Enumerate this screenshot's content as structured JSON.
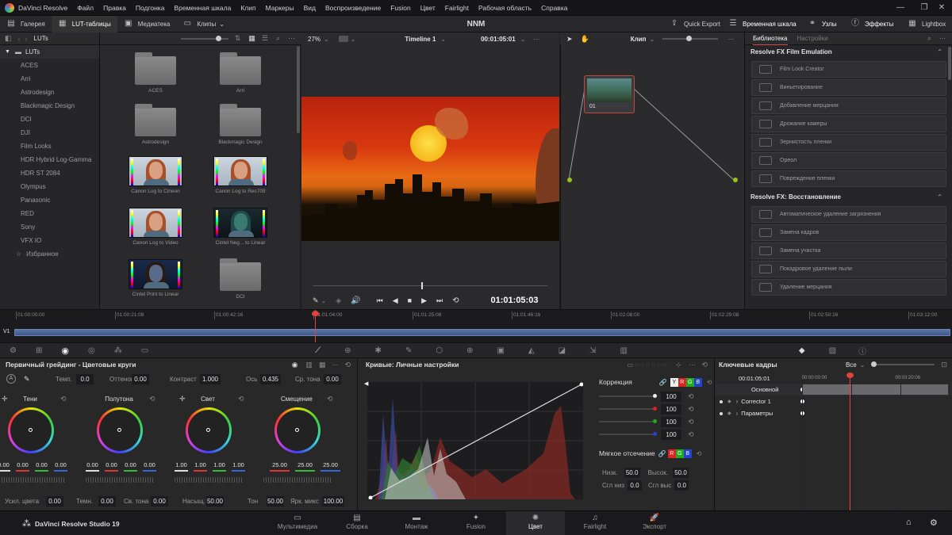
{
  "menubar": {
    "app_name": "DaVinci Resolve",
    "menus": [
      "Файл",
      "Правка",
      "Подгонка",
      "Временная шкала",
      "Клип",
      "Маркеры",
      "Вид",
      "Воспроизведение",
      "Fusion",
      "Цвет",
      "Fairlight",
      "Рабочая область",
      "Справка"
    ],
    "win_minimize": "—",
    "win_restore": "❐",
    "win_close": "✕"
  },
  "toolbar": {
    "gallery": "Галерея",
    "luts": "LUT-таблицы",
    "media": "Медиатека",
    "clips": "Клипы",
    "project_title": "NNM",
    "quick_export": "Quick Export",
    "timeline": "Временная шкала",
    "nodes": "Узлы",
    "effects": "Эффекты",
    "lightbox": "Lightbox"
  },
  "lut_browser": {
    "header": "LUTs",
    "tree_root": "LUTs",
    "folders": [
      "ACES",
      "Arri",
      "Astrodesign",
      "Blackmagic Design",
      "DCI",
      "DJI",
      "Film Looks",
      "HDR Hybrid Log-Gamma",
      "HDR ST 2084",
      "Olympus",
      "Panasonic",
      "RED",
      "Sony",
      "VFX IO"
    ],
    "favorites": "Избранное",
    "thumbs": [
      {
        "label": "ACES",
        "kind": "folder"
      },
      {
        "label": "Arri",
        "kind": "folder"
      },
      {
        "label": "Astrodesign",
        "kind": "folder"
      },
      {
        "label": "Blackmagic Design",
        "kind": "folder"
      },
      {
        "label": "Canon Log to Cineon",
        "kind": "image"
      },
      {
        "label": "Canon Log to Rec709",
        "kind": "image"
      },
      {
        "label": "Canon Log to Video",
        "kind": "image"
      },
      {
        "label": "Cintel Neg... to Linear",
        "kind": "image-dark"
      },
      {
        "label": "Cintel Print to Linear",
        "kind": "image-blue"
      },
      {
        "label": "DCI",
        "kind": "folder"
      }
    ]
  },
  "viewer": {
    "zoom": "27%",
    "timeline_name": "Timeline 1",
    "timecode_top": "00:01:05:01",
    "timecode": "01:01:05:03",
    "scrub_position": 0.46
  },
  "node_graph": {
    "mode": "Клип",
    "node_label": "01"
  },
  "library": {
    "tab_library": "Библиотека",
    "tab_settings": "Настройки",
    "sections": [
      {
        "title": "Resolve FX Film Emulation",
        "items": [
          "Film Look Creator",
          "Виньетирование",
          "Добавление мерцания",
          "Дрожание камеры",
          "Зернистость пленки",
          "Ореол",
          "Повреждение пленки"
        ]
      },
      {
        "title": "Resolve FX: Восстановление",
        "items": [
          "Автоматическое удаление загрязнения",
          "Замена кадров",
          "Замена участка",
          "Покадровое удаление пыли",
          "Удаление мерцания"
        ]
      }
    ]
  },
  "timeline": {
    "ticks": [
      "01:00:00:00",
      "01:00:21:08",
      "01:00:42:16",
      "01:01:04:00",
      "01:01:25:08",
      "01:01:46:16",
      "01:02:08:00",
      "01:02:29:08",
      "01:02:50:16",
      "01:03:12:00"
    ],
    "track": "V1",
    "playhead_position": 0.333
  },
  "primaries": {
    "title": "Первичный грейдинг - Цветовые круги",
    "top_params": [
      {
        "label": "Темп.",
        "value": "0.0"
      },
      {
        "label": "Оттенок",
        "value": "0.00"
      },
      {
        "label": "Контраст",
        "value": "1.000"
      },
      {
        "label": "Ось",
        "value": "0.435"
      },
      {
        "label": "Ср. тона",
        "value": "0.00"
      }
    ],
    "wheels": [
      {
        "name": "Тени",
        "values": [
          "0.00",
          "0.00",
          "0.00",
          "0.00"
        ]
      },
      {
        "name": "Полутона",
        "values": [
          "0.00",
          "0.00",
          "0.00",
          "0.00"
        ]
      },
      {
        "name": "Свет",
        "values": [
          "1.00",
          "1.00",
          "1.00",
          "1.00"
        ]
      },
      {
        "name": "Смещение",
        "values": [
          "25.00",
          "25.00",
          "25.00"
        ]
      }
    ],
    "bottom_params": [
      {
        "label": "Усил. цвета",
        "value": "0.00"
      },
      {
        "label": "Темн.",
        "value": "0.00"
      },
      {
        "label": "Св. тона",
        "value": "0.00"
      },
      {
        "label": "Насыщ.",
        "value": "50.00"
      },
      {
        "label": "Тон",
        "value": "50.00"
      },
      {
        "label": "Ярк. микс",
        "value": "100.00"
      }
    ]
  },
  "curves": {
    "title": "Кривые: Личные настройки",
    "correction_label": "Коррекция",
    "channel_letters": [
      "Y",
      "R",
      "G",
      "B"
    ],
    "channel_values": [
      "100",
      "100",
      "100",
      "100"
    ],
    "soft_clip_label": "Мягкое отсечение",
    "soft_clip_letters": [
      "R",
      "G",
      "B"
    ],
    "low_label": "Низк.",
    "low_value": "50.0",
    "high_label": "Высок.",
    "high_value": "50.0",
    "soft_low_label": "Сгл низ",
    "soft_low_value": "0.0",
    "soft_high_label": "Сгл выс",
    "soft_high_value": "0.0"
  },
  "keyframes": {
    "title": "Ключевые кадры",
    "filter": "Все",
    "timecode": "00:01:05:01",
    "ruler_start": "00:00:00:00",
    "ruler_end": "00:03:20:06",
    "tracks": [
      "Основной",
      "Corrector 1",
      "Параметры"
    ]
  },
  "pages": [
    {
      "label": "Мультимедиа",
      "icon": "media-icon"
    },
    {
      "label": "Сборка",
      "icon": "cut-icon"
    },
    {
      "label": "Монтаж",
      "icon": "edit-icon"
    },
    {
      "label": "Fusion",
      "icon": "fusion-icon"
    },
    {
      "label": "Цвет",
      "icon": "color-icon",
      "active": true
    },
    {
      "label": "Fairlight",
      "icon": "fairlight-icon"
    },
    {
      "label": "Экспорт",
      "icon": "deliver-icon"
    }
  ],
  "footer_brand": "DaVinci Resolve Studio 19",
  "colors": {
    "accent": "#d6453d",
    "playhead": "#e0443a",
    "active_page": "#ffffff"
  }
}
